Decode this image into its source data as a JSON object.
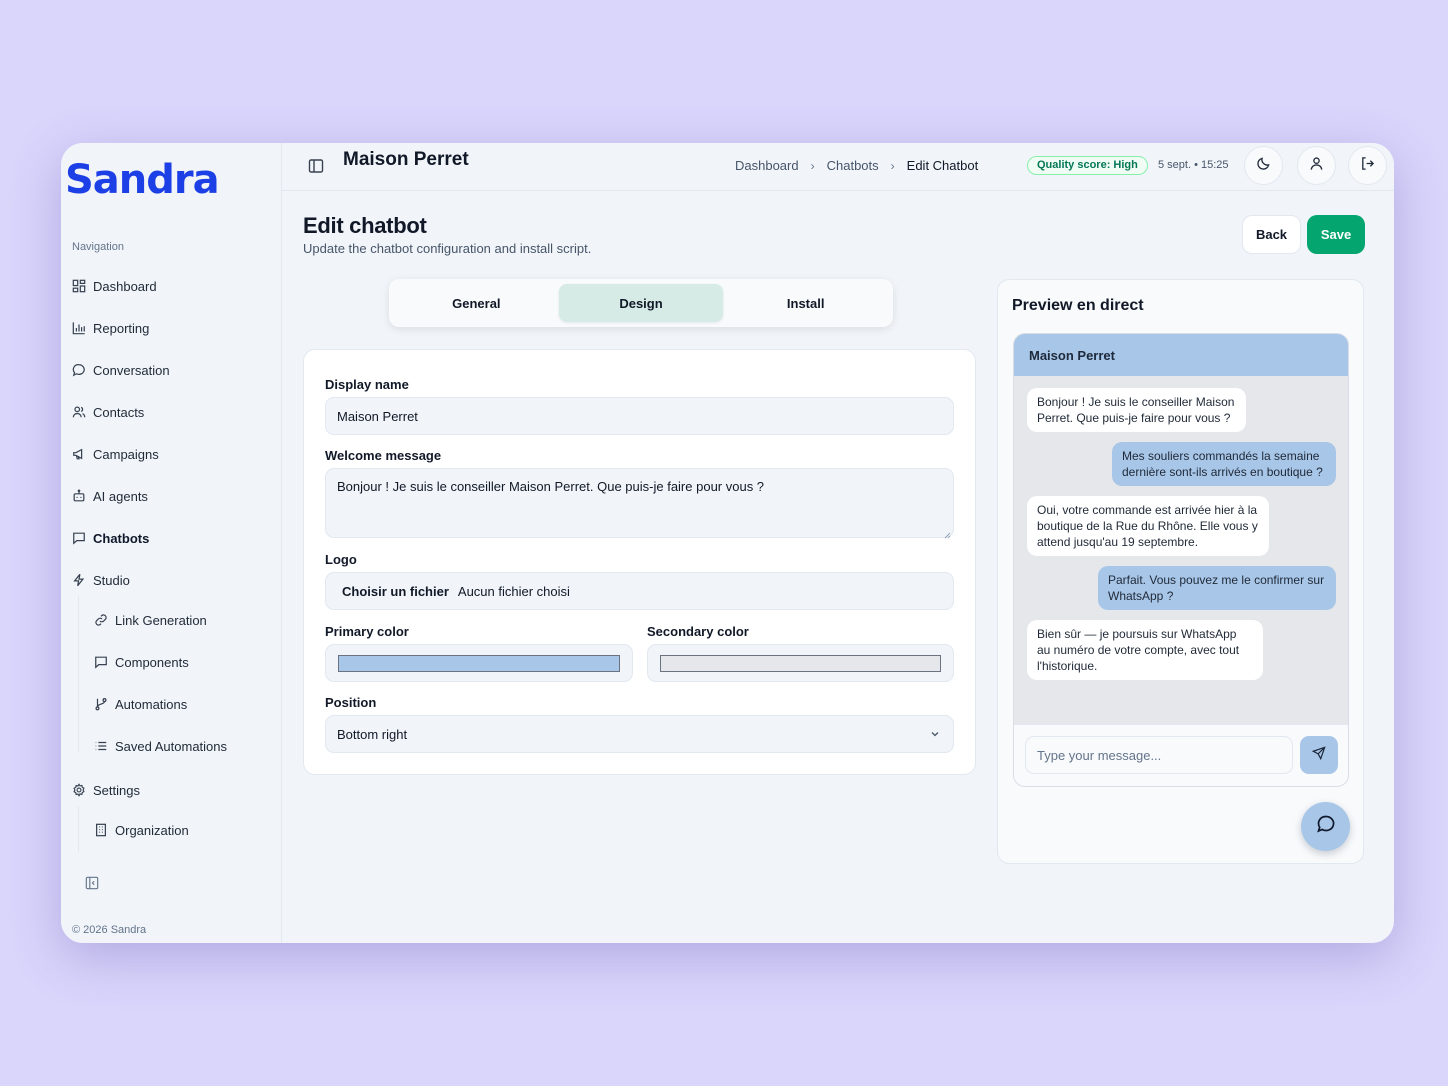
{
  "brand": {
    "name": "Sandra",
    "color": "#1d3fe6"
  },
  "sidebar": {
    "caption": "Navigation",
    "items": [
      {
        "label": "Dashboard",
        "icon": "grid-icon"
      },
      {
        "label": "Reporting",
        "icon": "bar-chart-icon"
      },
      {
        "label": "Conversation",
        "icon": "chat-bubble-icon"
      },
      {
        "label": "Contacts",
        "icon": "users-icon"
      },
      {
        "label": "Campaigns",
        "icon": "megaphone-icon"
      },
      {
        "label": "AI agents",
        "icon": "bot-icon"
      },
      {
        "label": "Chatbots",
        "icon": "message-square-icon",
        "active": true
      },
      {
        "label": "Studio",
        "icon": "zap-icon"
      }
    ],
    "studio_sub": [
      {
        "label": "Link Generation",
        "icon": "link-icon"
      },
      {
        "label": "Components",
        "icon": "message-square-icon"
      },
      {
        "label": "Automations",
        "icon": "git-branch-icon"
      },
      {
        "label": "Saved Automations",
        "icon": "list-icon"
      }
    ],
    "settings": {
      "label": "Settings",
      "icon": "gear-icon"
    },
    "settings_sub": [
      {
        "label": "Organization",
        "icon": "building-icon"
      }
    ],
    "copyright": "© 2026 Sandra"
  },
  "topbar": {
    "title": "Maison Perret",
    "breadcrumb": [
      "Dashboard",
      "Chatbots",
      "Edit Chatbot"
    ],
    "quality_badge": "Quality score: High",
    "datetime": "5 sept. • 15:25"
  },
  "page": {
    "title": "Edit chatbot",
    "subtitle": "Update the chatbot configuration and install script.",
    "back_label": "Back",
    "save_label": "Save"
  },
  "tabs": [
    {
      "label": "General"
    },
    {
      "label": "Design",
      "active": true
    },
    {
      "label": "Install"
    }
  ],
  "form": {
    "display_name_label": "Display name",
    "display_name_value": "Maison Perret",
    "welcome_label": "Welcome message",
    "welcome_value": "Bonjour ! Je suis le conseiller Maison Perret. Que puis-je faire pour vous ?",
    "logo_label": "Logo",
    "logo_button": "Choisir un fichier",
    "logo_status": "Aucun fichier choisi",
    "primary_color_label": "Primary color",
    "primary_color": "#a8c6e8",
    "secondary_color_label": "Secondary color",
    "secondary_color": "#e5e7eb",
    "position_label": "Position",
    "position_value": "Bottom right"
  },
  "preview": {
    "title": "Preview en direct",
    "chat_header": "Maison Perret",
    "messages": [
      {
        "from": "bot",
        "text": "Bonjour ! Je suis le conseiller Maison Perret. Que puis-je faire pour vous ?"
      },
      {
        "from": "user",
        "text": "Mes souliers commandés la semaine dernière sont-ils arrivés en boutique ?"
      },
      {
        "from": "bot",
        "text": "Oui, votre commande est arrivée hier à la boutique de la Rue du Rhône. Elle vous y attend jusqu'au 19 septembre."
      },
      {
        "from": "user",
        "text": "Parfait. Vous pouvez me le confirmer sur WhatsApp ?"
      },
      {
        "from": "bot",
        "text": "Bien sûr — je poursuis sur WhatsApp au numéro de votre compte, avec tout l'historique."
      }
    ],
    "input_placeholder": "Type your message..."
  }
}
